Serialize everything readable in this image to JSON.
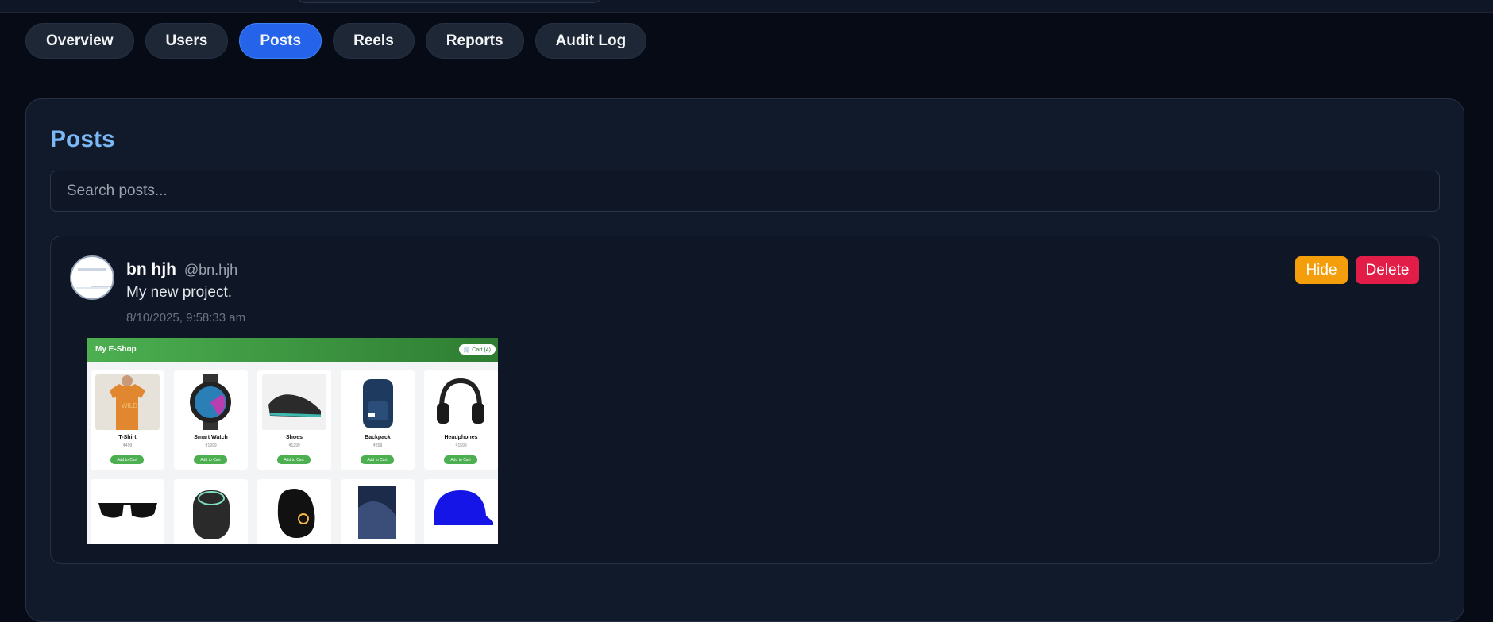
{
  "topbar": {},
  "tabs": [
    {
      "label": "Overview",
      "active": false
    },
    {
      "label": "Users",
      "active": false
    },
    {
      "label": "Posts",
      "active": true
    },
    {
      "label": "Reels",
      "active": false
    },
    {
      "label": "Reports",
      "active": false
    },
    {
      "label": "Audit Log",
      "active": false
    }
  ],
  "panel": {
    "title": "Posts",
    "search_placeholder": "Search posts...",
    "search_value": ""
  },
  "post": {
    "name": "bn hjh",
    "handle": "@bn.hjh",
    "text": "My new project.",
    "timestamp": "8/10/2025, 9:58:33 am",
    "hide_label": "Hide",
    "delete_label": "Delete"
  },
  "shop": {
    "title": "My E-Shop",
    "cart_label": "🛒 Cart (4)",
    "add_label": "Add to Cart",
    "products_row1": [
      {
        "name": "T-Shirt",
        "price": "₹499"
      },
      {
        "name": "Smart Watch",
        "price": "₹1999"
      },
      {
        "name": "Shoes",
        "price": "₹1299"
      },
      {
        "name": "Backpack",
        "price": "₹899"
      },
      {
        "name": "Headphones",
        "price": "₹1599"
      }
    ]
  },
  "colors": {
    "accent": "#2563eb",
    "title": "#7cb8f5",
    "hide": "#f59e0b",
    "delete": "#e11d48"
  }
}
